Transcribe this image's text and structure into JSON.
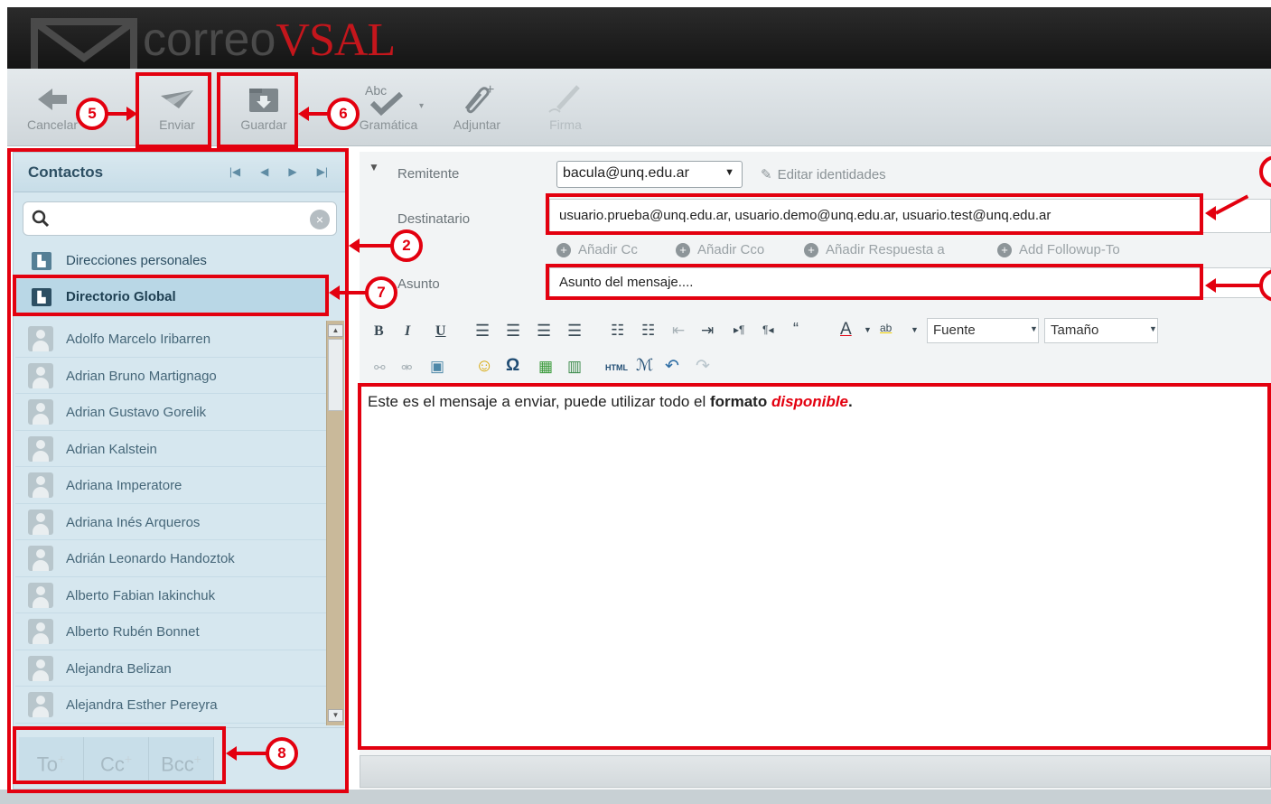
{
  "app": {
    "logo_prefix": "correo",
    "logo_brand": "VSAL"
  },
  "toolbar": {
    "cancel": "Cancelar",
    "send": "Enviar",
    "save": "Guardar",
    "grammar": "Gramática",
    "grammar_abc": "Abc",
    "attach": "Adjuntar",
    "sign": "Firma"
  },
  "callouts": {
    "c2": "2",
    "c5": "5",
    "c6": "6",
    "c7": "7",
    "c8": "8"
  },
  "contacts": {
    "title": "Contactos",
    "search_placeholder": "",
    "books": [
      {
        "label": "Direcciones personales"
      },
      {
        "label": "Directorio Global"
      }
    ],
    "items": [
      "Adolfo Marcelo Iribarren",
      "Adrian Bruno Martignago",
      "Adrian Gustavo Gorelik",
      "Adrian Kalstein",
      "Adriana Imperatore",
      "Adriana Inés Arqueros",
      "Adrián Leonardo Handoztok",
      "Alberto Fabian Iakinchuk",
      "Alberto Rubén Bonnet",
      "Alejandra Belizan",
      "Alejandra Esther Pereyra"
    ],
    "recipient_buttons": {
      "to": "To",
      "cc": "Cc",
      "bcc": "Bcc"
    }
  },
  "compose": {
    "from_label": "Remitente",
    "from_value": "bacula@unq.edu.ar",
    "edit_identities": "Editar identidades",
    "to_label": "Destinatario",
    "to_value": "usuario.prueba@unq.edu.ar, usuario.demo@unq.edu.ar, usuario.test@unq.edu.ar",
    "add_cc": "Añadir Cc",
    "add_bcc": "Añadir Cco",
    "add_reply": "Añadir Respuesta a",
    "add_followup": "Add Followup-To",
    "subject_label": "Asunto",
    "subject_value": "Asunto del mensaje....",
    "font_select": "Fuente",
    "size_select": "Tamaño",
    "body_plain": "Este es el mensaje a enviar, puede utilizar todo el ",
    "body_bold": "formato",
    "body_red": "disponible",
    "body_end": "."
  },
  "colors": {
    "annotation_red": "#e3000f",
    "brand_red": "#c4161c"
  }
}
